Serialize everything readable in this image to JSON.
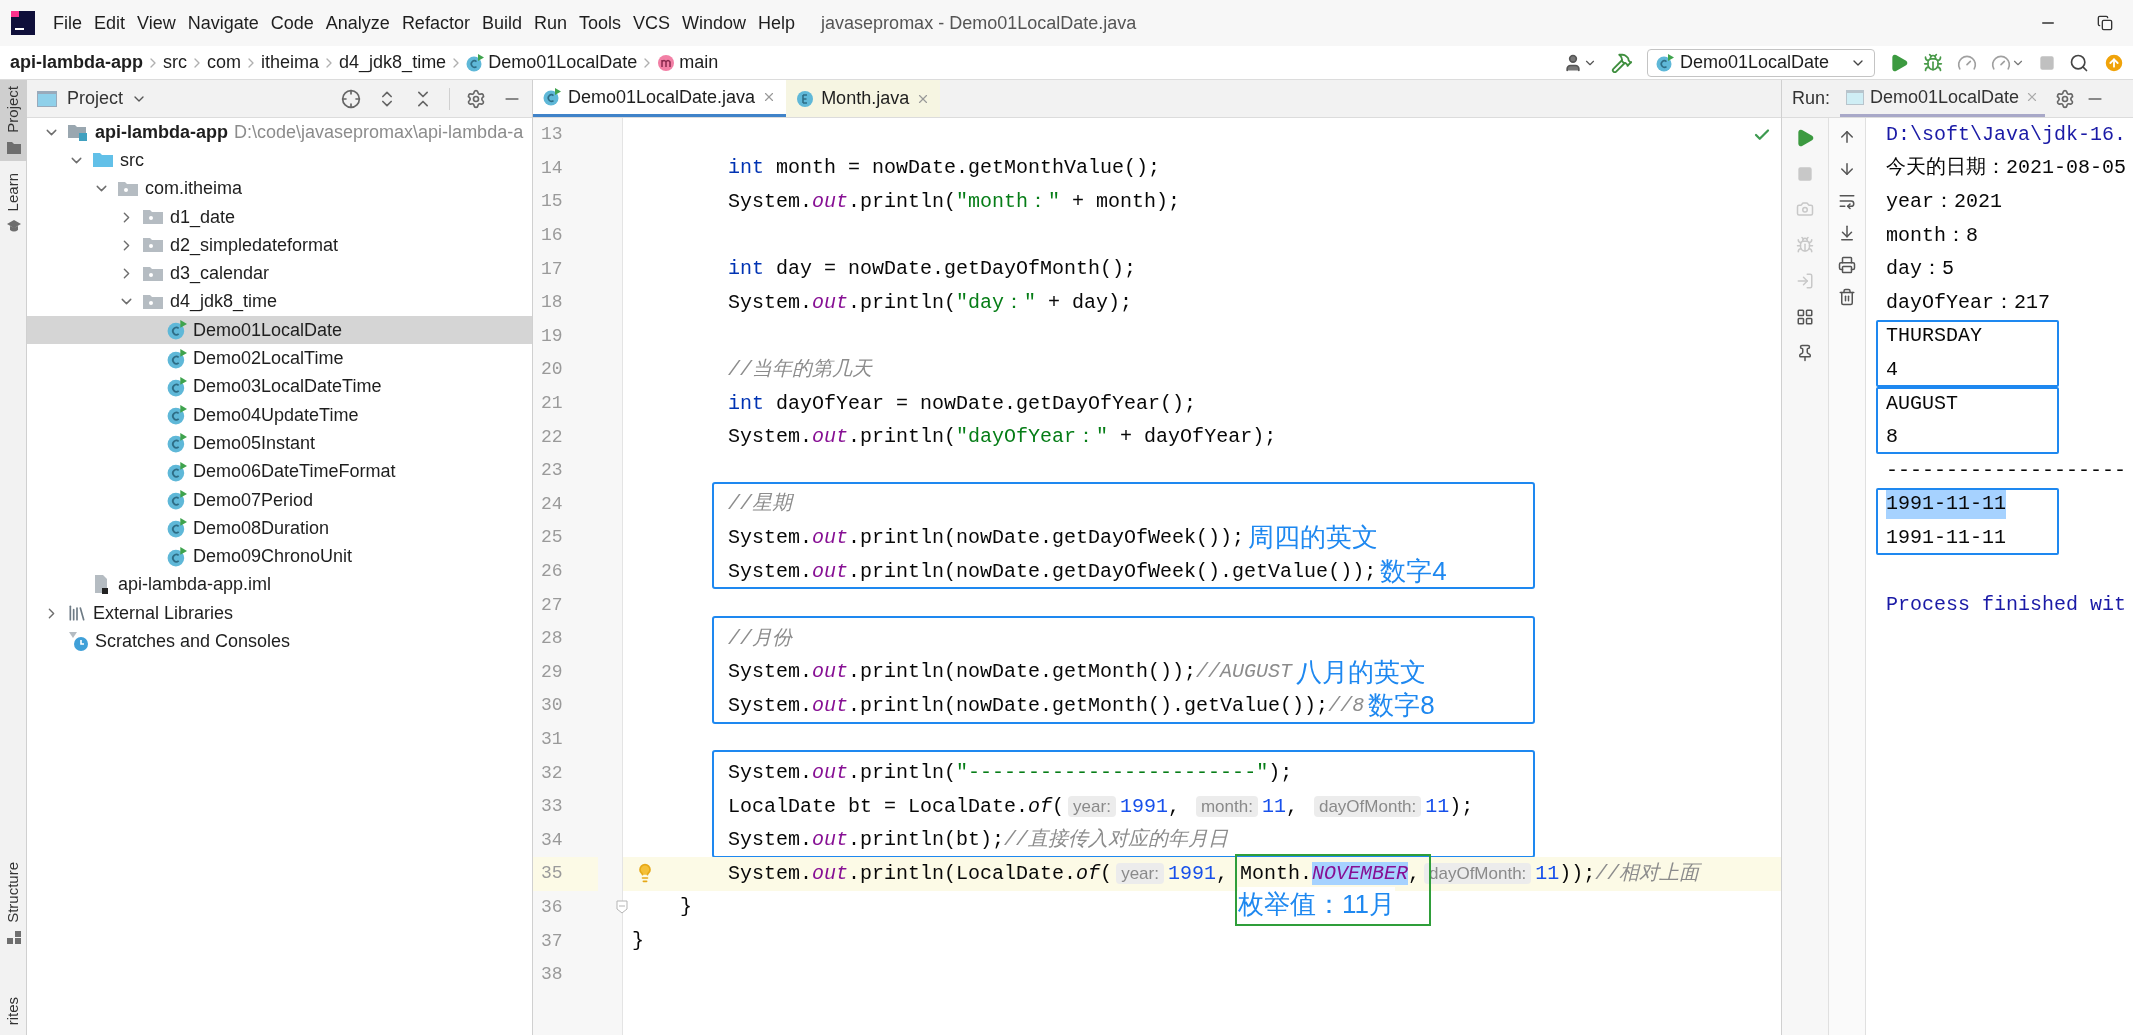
{
  "window": {
    "title": "javasepromax - Demo01LocalDate.java"
  },
  "menu": [
    "File",
    "Edit",
    "View",
    "Navigate",
    "Code",
    "Analyze",
    "Refactor",
    "Build",
    "Run",
    "Tools",
    "VCS",
    "Window",
    "Help"
  ],
  "breadcrumbs": [
    {
      "label": "api-lambda-app",
      "kind": "project"
    },
    {
      "label": "src",
      "kind": "plain"
    },
    {
      "label": "com",
      "kind": "plain"
    },
    {
      "label": "itheima",
      "kind": "plain"
    },
    {
      "label": "d4_jdk8_time",
      "kind": "plain"
    },
    {
      "label": "Demo01LocalDate",
      "kind": "class"
    },
    {
      "label": "main",
      "kind": "method"
    }
  ],
  "run_config": "Demo01LocalDate",
  "side_tabs_top": [
    {
      "label": "Project",
      "kind": "folder",
      "selected": true
    },
    {
      "label": "Learn",
      "kind": "learn",
      "selected": false
    }
  ],
  "side_tabs_bottom": [
    {
      "label": "Structure",
      "kind": "structure",
      "selected": false
    },
    {
      "label": "rites",
      "kind": "none",
      "selected": false
    }
  ],
  "project_panel": {
    "title": "Project",
    "tree": [
      {
        "label": "api-lambda-app",
        "kind": "module",
        "detail": "D:\\code\\javasepromax\\api-lambda-a",
        "expanded": true,
        "selected": false,
        "children": [
          {
            "label": "src",
            "kind": "source",
            "expanded": true,
            "selected": false,
            "children": [
              {
                "label": "com.itheima",
                "kind": "package",
                "expanded": true,
                "selected": false,
                "children": [
                  {
                    "label": "d1_date",
                    "kind": "package",
                    "expanded": false,
                    "selected": false
                  },
                  {
                    "label": "d2_simpledateformat",
                    "kind": "package",
                    "expanded": false,
                    "selected": false
                  },
                  {
                    "label": "d3_calendar",
                    "kind": "package",
                    "expanded": false,
                    "selected": false
                  },
                  {
                    "label": "d4_jdk8_time",
                    "kind": "package",
                    "expanded": true,
                    "selected": false,
                    "children": [
                      {
                        "label": "Demo01LocalDate",
                        "kind": "class",
                        "selected": true
                      },
                      {
                        "label": "Demo02LocalTime",
                        "kind": "class",
                        "selected": false
                      },
                      {
                        "label": "Demo03LocalDateTime",
                        "kind": "class",
                        "selected": false
                      },
                      {
                        "label": "Demo04UpdateTime",
                        "kind": "class",
                        "selected": false
                      },
                      {
                        "label": "Demo05Instant",
                        "kind": "class",
                        "selected": false
                      },
                      {
                        "label": "Demo06DateTimeFormat",
                        "kind": "class",
                        "selected": false
                      },
                      {
                        "label": "Demo07Period",
                        "kind": "class",
                        "selected": false
                      },
                      {
                        "label": "Demo08Duration",
                        "kind": "class",
                        "selected": false
                      },
                      {
                        "label": "Demo09ChronoUnit",
                        "kind": "class",
                        "selected": false
                      }
                    ]
                  }
                ]
              }
            ]
          },
          {
            "label": "api-lambda-app.iml",
            "kind": "file",
            "selected": false
          }
        ]
      },
      {
        "label": "External Libraries",
        "kind": "libraries",
        "expanded": false,
        "selected": false
      },
      {
        "label": "Scratches and Consoles",
        "kind": "scratches",
        "selected": false
      }
    ]
  },
  "editor": {
    "tabs": [
      {
        "label": "Demo01LocalDate.java",
        "kind": "class",
        "selected": true
      },
      {
        "label": "Month.java",
        "kind": "enum",
        "selected": false
      }
    ],
    "blocks": [
      {
        "boxed": false,
        "lines": [
          {
            "number": "13",
            "kind": "plain",
            "current": false
          },
          {
            "number": "14",
            "kind": "plain",
            "current": false,
            "tokens": [
              {
                "kind": "keyword",
                "text": "        int"
              },
              {
                "kind": "plain",
                "text": " month = nowDate.getMonthValue();"
              }
            ]
          },
          {
            "number": "15",
            "kind": "plain",
            "current": false,
            "tokens": [
              {
                "kind": "plain",
                "text": "        System."
              },
              {
                "kind": "field",
                "text": "out"
              },
              {
                "kind": "plain",
                "text": ".println("
              },
              {
                "kind": "string",
                "text": "\"month：\""
              },
              {
                "kind": "plain",
                "text": " + month);"
              }
            ]
          },
          {
            "number": "16",
            "kind": "plain",
            "current": false
          },
          {
            "number": "17",
            "kind": "plain",
            "current": false,
            "tokens": [
              {
                "kind": "keyword",
                "text": "        int"
              },
              {
                "kind": "plain",
                "text": " day = nowDate.getDayOfMonth();"
              }
            ]
          },
          {
            "number": "18",
            "kind": "plain",
            "current": false,
            "tokens": [
              {
                "kind": "plain",
                "text": "        System."
              },
              {
                "kind": "field",
                "text": "out"
              },
              {
                "kind": "plain",
                "text": ".println("
              },
              {
                "kind": "string",
                "text": "\"day：\""
              },
              {
                "kind": "plain",
                "text": " + day);"
              }
            ]
          },
          {
            "number": "19",
            "kind": "plain",
            "current": false
          },
          {
            "number": "20",
            "kind": "plain",
            "current": false,
            "tokens": [
              {
                "kind": "comment",
                "text": "        //当年的第几天"
              }
            ]
          },
          {
            "number": "21",
            "kind": "plain",
            "current": false,
            "tokens": [
              {
                "kind": "keyword",
                "text": "        int"
              },
              {
                "kind": "plain",
                "text": " dayOfYear = nowDate.getDayOfYear();"
              }
            ]
          },
          {
            "number": "22",
            "kind": "plain",
            "current": false,
            "tokens": [
              {
                "kind": "plain",
                "text": "        System."
              },
              {
                "kind": "field",
                "text": "out"
              },
              {
                "kind": "plain",
                "text": ".println("
              },
              {
                "kind": "string",
                "text": "\"dayOfYear：\""
              },
              {
                "kind": "plain",
                "text": " + dayOfYear);"
              }
            ]
          },
          {
            "number": "23",
            "kind": "plain",
            "current": false
          }
        ]
      },
      {
        "boxed": true,
        "lines": [
          {
            "number": "24",
            "kind": "plain",
            "current": false,
            "tokens": [
              {
                "kind": "comment",
                "text": "        //星期"
              }
            ]
          },
          {
            "number": "25",
            "kind": "plain",
            "current": false,
            "tokens": [
              {
                "kind": "plain",
                "text": "        System."
              },
              {
                "kind": "field",
                "text": "out"
              },
              {
                "kind": "plain",
                "text": ".println(nowDate.getDayOfWeek());"
              }
            ],
            "note": "周四的英文"
          },
          {
            "number": "26",
            "kind": "plain",
            "current": false,
            "tokens": [
              {
                "kind": "plain",
                "text": "        System."
              },
              {
                "kind": "field",
                "text": "out"
              },
              {
                "kind": "plain",
                "text": ".println(nowDate.getDayOfWeek().getValue());"
              }
            ],
            "note": "数字4"
          }
        ]
      },
      {
        "boxed": false,
        "lines": [
          {
            "number": "27",
            "kind": "plain",
            "current": false
          }
        ]
      },
      {
        "boxed": true,
        "lines": [
          {
            "number": "28",
            "kind": "plain",
            "current": false,
            "tokens": [
              {
                "kind": "comment",
                "text": "        //月份"
              }
            ]
          },
          {
            "number": "29",
            "kind": "plain",
            "current": false,
            "tokens": [
              {
                "kind": "plain",
                "text": "        System."
              },
              {
                "kind": "field",
                "text": "out"
              },
              {
                "kind": "plain",
                "text": ".println(nowDate.getMonth());"
              },
              {
                "kind": "comment",
                "text": "//AUGUST"
              }
            ],
            "note": "八月的英文"
          },
          {
            "number": "30",
            "kind": "plain",
            "current": false,
            "tokens": [
              {
                "kind": "plain",
                "text": "        System."
              },
              {
                "kind": "field",
                "text": "out"
              },
              {
                "kind": "plain",
                "text": ".println(nowDate.getMonth().getValue());"
              },
              {
                "kind": "comment",
                "text": "//8"
              }
            ],
            "note": "数字8"
          }
        ]
      },
      {
        "boxed": false,
        "lines": [
          {
            "number": "31",
            "kind": "plain",
            "current": false
          }
        ]
      },
      {
        "boxed": true,
        "lines": [
          {
            "number": "32",
            "kind": "plain",
            "current": false,
            "tokens": [
              {
                "kind": "plain",
                "text": "        System."
              },
              {
                "kind": "field",
                "text": "out"
              },
              {
                "kind": "plain",
                "text": ".println("
              },
              {
                "kind": "string",
                "text": "\"------------------------\""
              },
              {
                "kind": "plain",
                "text": ");"
              }
            ]
          },
          {
            "number": "33",
            "kind": "plain",
            "current": false,
            "tokens": [
              {
                "kind": "plain",
                "text": "        LocalDate bt = LocalDate."
              },
              {
                "kind": "static",
                "text": "of"
              },
              {
                "kind": "plain",
                "text": "("
              },
              {
                "kind": "hint",
                "text": "year:"
              },
              {
                "kind": "number",
                "text": "1991"
              },
              {
                "kind": "plain",
                "text": ", "
              },
              {
                "kind": "hint",
                "text": "month:"
              },
              {
                "kind": "number",
                "text": "11"
              },
              {
                "kind": "plain",
                "text": ", "
              },
              {
                "kind": "hint",
                "text": "dayOfMonth:"
              },
              {
                "kind": "number",
                "text": "11"
              },
              {
                "kind": "plain",
                "text": ");"
              }
            ]
          },
          {
            "number": "34",
            "kind": "plain",
            "current": false,
            "tokens": [
              {
                "kind": "plain",
                "text": "        System."
              },
              {
                "kind": "field",
                "text": "out"
              },
              {
                "kind": "plain",
                "text": ".println(bt);"
              },
              {
                "kind": "comment",
                "text": "//直接传入对应的年月日"
              }
            ]
          }
        ]
      },
      {
        "boxed": false,
        "lines": [
          {
            "number": "35",
            "kind": "bulb",
            "current": true,
            "tokens": [
              {
                "kind": "plain",
                "text": "        System."
              },
              {
                "kind": "field",
                "text": "out"
              },
              {
                "kind": "plain",
                "text": ".println(LocalDate."
              },
              {
                "kind": "static",
                "text": "of"
              },
              {
                "kind": "plain",
                "text": "("
              },
              {
                "kind": "hint",
                "text": "year:"
              },
              {
                "kind": "number",
                "text": "1991"
              },
              {
                "kind": "plain",
                "text": ", "
              },
              {
                "kind": "callout",
                "note": "枚举值：11月",
                "tokens": [
                  {
                    "kind": "plain",
                    "text": "Month."
                  },
                  {
                    "kind": "selected_field",
                    "text": "NOVEMBER"
                  },
                  {
                    "kind": "plain",
                    "text": ","
                  }
                ]
              },
              {
                "kind": "hint",
                "text": "dayOfMonth:"
              },
              {
                "kind": "number",
                "text": "11"
              },
              {
                "kind": "plain",
                "text": "));"
              },
              {
                "kind": "comment",
                "text": "//相对上面"
              }
            ]
          },
          {
            "number": "36",
            "kind": "fold",
            "current": false,
            "tokens": [
              {
                "kind": "plain",
                "text": "    }"
              }
            ]
          },
          {
            "number": "37",
            "kind": "plain",
            "current": false,
            "tokens": [
              {
                "kind": "plain",
                "text": "}"
              }
            ]
          },
          {
            "number": "38",
            "kind": "plain",
            "current": false
          }
        ]
      }
    ]
  },
  "run_panel": {
    "label": "Run:",
    "tab": "Demo01LocalDate",
    "console": [
      {
        "boxed": false,
        "lines": [
          {
            "kind": "system",
            "text": "D:\\soft\\Java\\jdk-16."
          },
          {
            "kind": "output",
            "text": "今天的日期：2021-08-05"
          },
          {
            "kind": "output",
            "text": "year：2021"
          },
          {
            "kind": "output",
            "text": "month：8"
          },
          {
            "kind": "output",
            "text": "day：5"
          },
          {
            "kind": "output",
            "text": "dayOfYear：217"
          }
        ]
      },
      {
        "boxed": true,
        "lines": [
          {
            "kind": "output",
            "text": "THURSDAY"
          },
          {
            "kind": "output",
            "text": "4"
          }
        ]
      },
      {
        "boxed": true,
        "lines": [
          {
            "kind": "output",
            "text": "AUGUST"
          },
          {
            "kind": "output",
            "text": "8"
          }
        ]
      },
      {
        "boxed": false,
        "lines": [
          {
            "kind": "output",
            "text": "--------------------"
          }
        ]
      },
      {
        "boxed": true,
        "lines": [
          {
            "kind": "selected",
            "text": "1991-11-11"
          },
          {
            "kind": "output",
            "text": "1991-11-11"
          }
        ]
      },
      {
        "boxed": false,
        "lines": [
          {
            "kind": "exit",
            "text": "Process finished wit"
          }
        ]
      }
    ]
  }
}
